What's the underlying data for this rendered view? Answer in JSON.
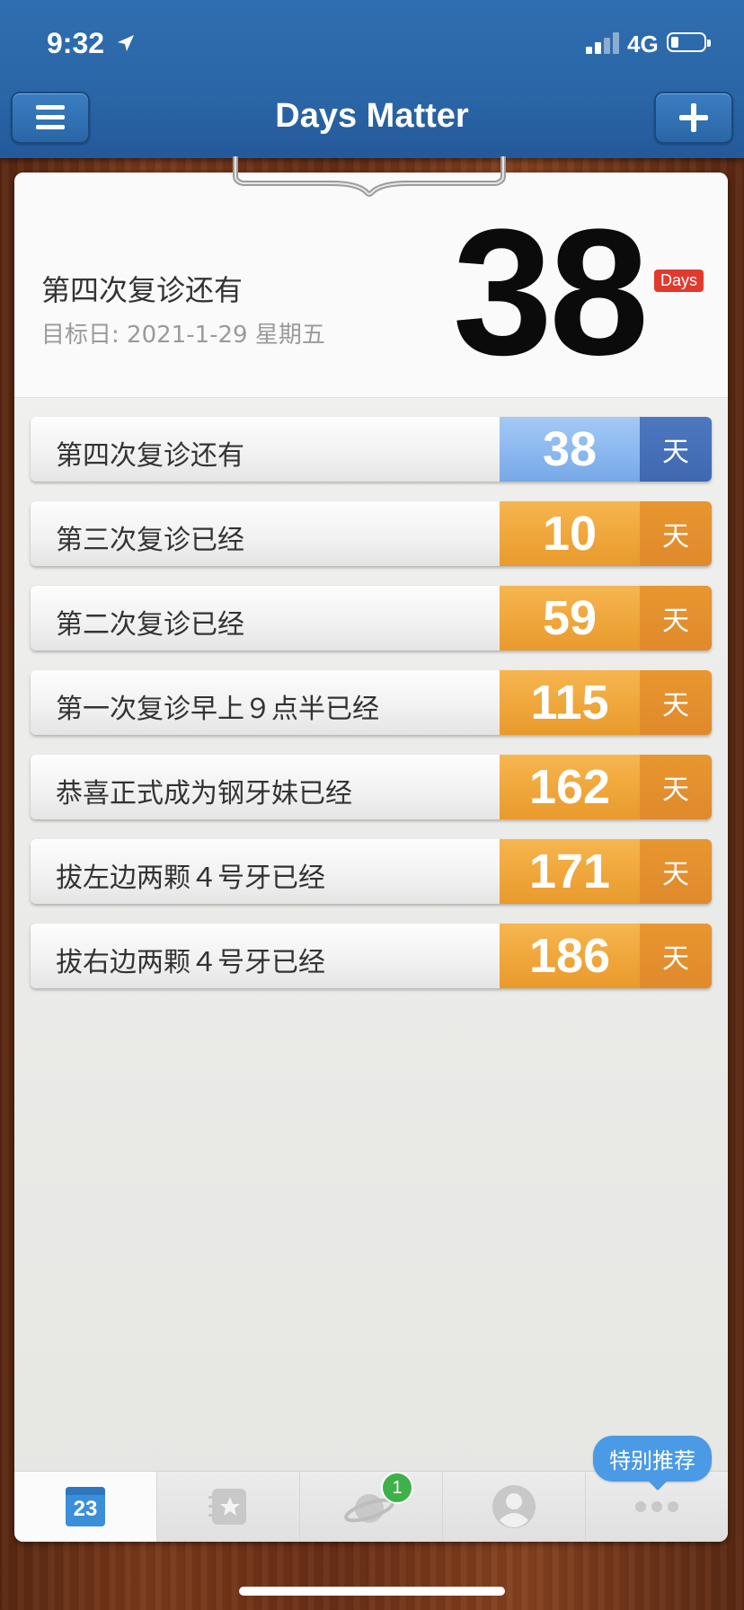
{
  "status_bar": {
    "time": "9:32",
    "network": "4G"
  },
  "app": {
    "title": "Days Matter"
  },
  "hero": {
    "title": "第四次复诊还有",
    "target_date": "目标日: 2021-1-29 星期五",
    "days": "38",
    "days_badge": "Days"
  },
  "events": [
    {
      "label": "第四次复诊还有",
      "days": "38",
      "unit": "天",
      "type": "countdown"
    },
    {
      "label": "第三次复诊已经",
      "days": "10",
      "unit": "天",
      "type": "elapsed"
    },
    {
      "label": "第二次复诊已经",
      "days": "59",
      "unit": "天",
      "type": "elapsed"
    },
    {
      "label": "第一次复诊早上９点半已经",
      "days": "115",
      "unit": "天",
      "type": "elapsed"
    },
    {
      "label": "恭喜正式成为钢牙妹已经",
      "days": "162",
      "unit": "天",
      "type": "elapsed"
    },
    {
      "label": "拔左边两颗４号牙已经",
      "days": "171",
      "unit": "天",
      "type": "elapsed"
    },
    {
      "label": "拔右边两颗４号牙已经",
      "days": "186",
      "unit": "天",
      "type": "elapsed"
    }
  ],
  "colors": {
    "countdown_num": "#8ab8ef",
    "countdown_unit": "#3f68b0",
    "elapsed_num": "#efa63a",
    "elapsed_unit": "#e08a2c",
    "header_blue": "#2a66a6",
    "badge_red": "#e03a2e"
  },
  "tabbar": {
    "calendar_day": "23",
    "notification_count": "1",
    "promo": "特别推荐",
    "icons": [
      "calendar-icon",
      "notebook-icon",
      "planet-icon",
      "user-icon",
      "more-icon"
    ]
  }
}
